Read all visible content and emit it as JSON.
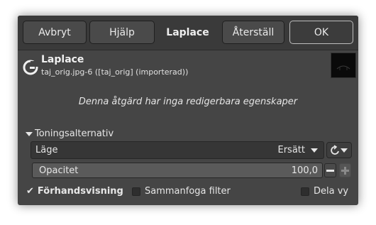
{
  "header": {
    "cancel_label": "Avbryt",
    "help_label": "Hjälp",
    "title": "Laplace",
    "reset_label": "Återställ",
    "ok_label": "OK"
  },
  "operation": {
    "name": "Laplace",
    "source": "taj_orig.jpg-6 ([taj_orig] (importerad))",
    "no_properties": "Denna åtgärd har inga redigerbara egenskaper"
  },
  "blending": {
    "expander_label": "Toningsalternativ",
    "mode_label": "Läge",
    "mode_value": "Ersätt",
    "opacity_label": "Opacitet",
    "opacity_value": "100,0",
    "opacity_fraction": 1.0
  },
  "footer": {
    "preview_label": "Förhandsvisning",
    "preview_checked": true,
    "merge_label": "Sammanfoga filter",
    "merge_checked": false,
    "split_label": "Dela vy",
    "split_checked": false
  },
  "colors": {
    "dialog_bg": "#454545",
    "header_bg": "#3a3a3a",
    "text": "#e6e6e6"
  }
}
